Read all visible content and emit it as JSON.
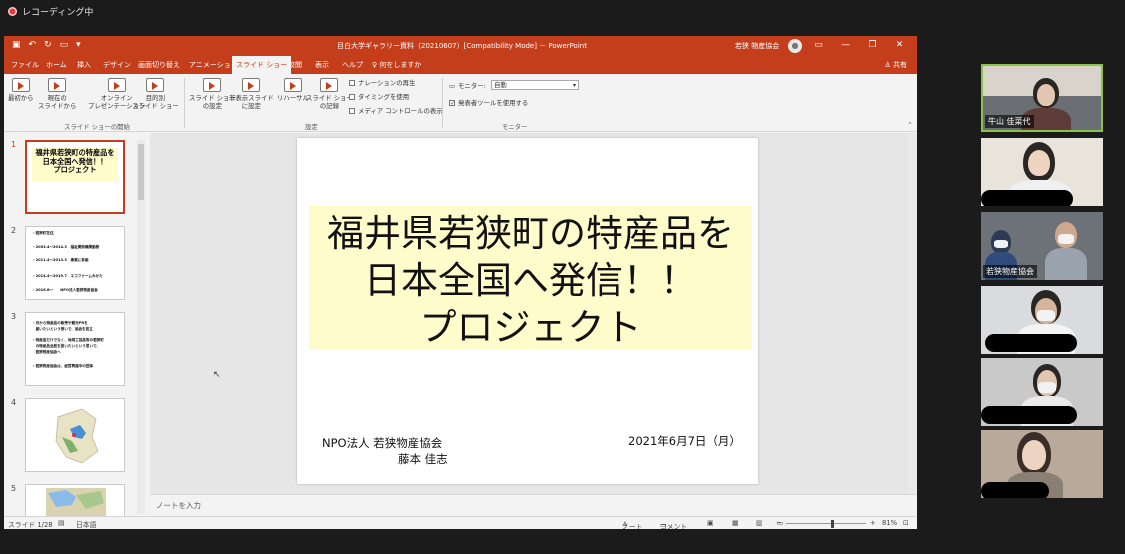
{
  "recording": {
    "label": "レコーディング中"
  },
  "powerpoint": {
    "titlebar": {
      "document_title": "目白大学ギャラリー資料（20210607）[Compatibility Mode] － PowerPoint",
      "user_name": "若狭 物産協会"
    },
    "tabs": [
      "ファイル",
      "ホーム",
      "挿入",
      "デザイン",
      "画面切り替え",
      "アニメーション",
      "スライド ショー",
      "校閲",
      "表示",
      "ヘルプ",
      "何をしますか"
    ],
    "active_tab": "スライド ショー",
    "share_label": "共有",
    "ribbon": {
      "btn_from_start": "最初から",
      "btn_from_current_1": "現在の",
      "btn_from_current_2": "スライドから",
      "btn_online_1": "オンライン",
      "btn_online_2": "プレゼンテーション",
      "btn_custom_1": "目的別",
      "btn_custom_2": "スライド ショー",
      "group_start": "スライド ショーの開始",
      "btn_setup_1": "スライド ショー",
      "btn_setup_2": "の設定",
      "btn_hide_1": "非表示スライド",
      "btn_hide_2": "に設定",
      "btn_rehearse": "リハーサル",
      "btn_record_1": "スライド ショー",
      "btn_record_2": "の記録",
      "chk_narration": "ナレーションの再生",
      "chk_timing": "タイミングを使用",
      "chk_media": "メディア コントロールの表示",
      "group_setup": "設定",
      "monitor_label": "モニター:",
      "monitor_value": "自動",
      "presenter_view": "発表者ツールを使用する",
      "group_monitor": "モニター"
    },
    "thumbnails": {
      "s1_num": "1",
      "s1_title": "福井県若狭町の特産品を\n日本全国へ発信！！\nプロジェクト",
      "s2_num": "2",
      "s2_lines": [
        "・若狭町在住",
        "・2003.4〜2014.3　福祉関係機関勤務",
        "・2011.4〜2013.3　事業に参画",
        "・2014.4〜2019.7　エコファームみかた",
        "・2016.8〜　　NPO法人若狭物産協会"
      ],
      "s3_num": "3",
      "s3_lines": [
        "・月から特産品の販売や観光PRを",
        "　届いたいという想いで、協会を設立",
        "・特産品だけでなく、地域工芸品等の若狭町",
        "　の特産品全般を扱いたいという思いで、",
        "　若狭物産協会へ",
        "・若狭物産協会は、経営再建中の団体"
      ],
      "s4_num": "4",
      "s5_num": "5"
    },
    "slide": {
      "title": "福井県若狭町の特産品を\n日本全国へ発信！！\nプロジェクト",
      "organization": "NPO法人 若狭物産協会",
      "author": "藤本 佳志",
      "date": "2021年6月7日（月）"
    },
    "notes_placeholder": "ノートを入力",
    "statusbar": {
      "slide_count": "スライド 1/28",
      "language": "日本語",
      "notes_btn": "ノート",
      "comments_btn": "コメント",
      "zoom": "81%"
    }
  },
  "participants": [
    {
      "name": "牛山 佳菜代",
      "active": true
    },
    {
      "name": ""
    },
    {
      "name": "若狭物産協会"
    },
    {
      "name": ""
    },
    {
      "name": ""
    },
    {
      "name": ""
    }
  ],
  "colors": {
    "ppt_accent": "#c43e1c",
    "slide_title_bg": "#fffccc",
    "active_speaker": "#8bc34a",
    "background": "#1b1b1b"
  }
}
